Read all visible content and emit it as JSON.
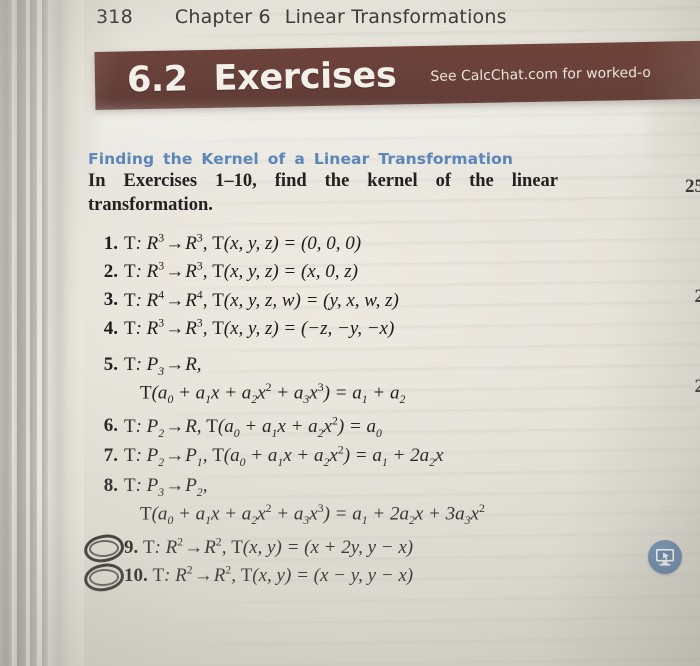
{
  "running_head": {
    "page_number": "318",
    "chapter_label": "Chapter 6",
    "chapter_title": "Linear Transformations"
  },
  "banner": {
    "section_number": "6.2",
    "section_word": "Exercises",
    "tagline": "See CalcChat.com for worked-o",
    "background_color": "#6b4038",
    "text_color": "#f3efe9"
  },
  "directions": {
    "heading": "Finding the Kernel of a Linear Transformation",
    "heading_color": "#5b86b9",
    "text": "In Exercises 1–10, find the kernel of the linear transformation."
  },
  "exercises": [
    {
      "number": "1.",
      "line1": "T: R3 → R3, T(x, y, z) = (0, 0, 0)"
    },
    {
      "number": "2.",
      "line1": "T: R3 → R3, T(x, y, z) = (x, 0, z)"
    },
    {
      "number": "3.",
      "line1": "T: R4 → R4, T(x, y, z, w) = (y, x, w, z)"
    },
    {
      "number": "4.",
      "line1": "T: R3 → R3, T(x, y, z) = (−z, −y, −x)"
    },
    {
      "number": "5.",
      "line1": "T: P3 → R,",
      "line2": "T(a0 + a1x + a2x2 + a3x3) = a1 + a2"
    },
    {
      "number": "6.",
      "line1": "T: P2 → R, T(a0 + a1x + a2x2) = a0"
    },
    {
      "number": "7.",
      "line1": "T: P2 → P1, T(a0 + a1x + a2x2) = a1 + 2a2x"
    },
    {
      "number": "8.",
      "line1": "T: P3 → P2,",
      "line2": "T(a0 + a1x + a2x2 + a3x3) = a1 + 2a2x + 3a3x2"
    },
    {
      "number": "9.",
      "line1": "T: R2 → R2, T(x, y) = (x + 2y, y − x)",
      "annotated": true
    },
    {
      "number": "10.",
      "line1": "T: R2 → R2, T(x, y) = (x − y, y − x)",
      "annotated": true
    }
  ],
  "right_margin_numbers": [
    "25",
    "2",
    "2"
  ],
  "tech_icon": {
    "name": "computer-monitor-cursor-icon",
    "color": "#3f6a9c"
  }
}
